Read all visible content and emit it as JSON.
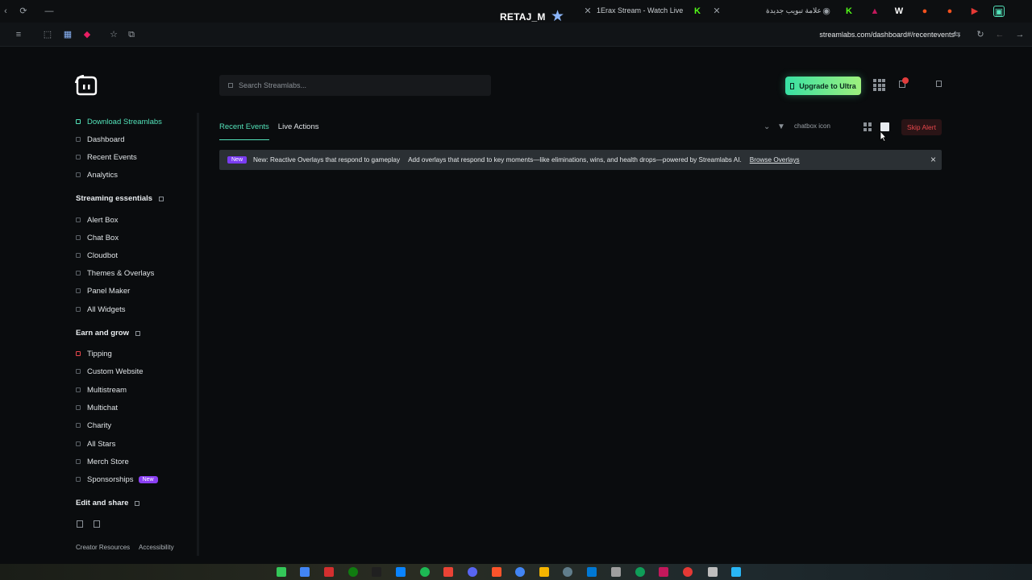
{
  "browser": {
    "tabs": [
      {
        "label": "RETAJ_M"
      },
      {
        "label": "1Erax Stream - Watch Live on K"
      },
      {
        "label": "علامة تبويب جديدة"
      }
    ],
    "url": "streamlabs.com/dashboard#/recentevents"
  },
  "header": {
    "search_placeholder": "Search Streamlabs...",
    "upgrade_label": "Upgrade to Ultra"
  },
  "sidebar": {
    "top_items": [
      {
        "label": "Download Streamlabs"
      },
      {
        "label": "Dashboard"
      },
      {
        "label": "Recent Events"
      },
      {
        "label": "Analytics"
      }
    ],
    "sections": [
      {
        "title": "Streaming essentials",
        "items": [
          "Alert Box",
          "Chat Box",
          "Cloudbot",
          "Themes & Overlays",
          "Panel Maker",
          "All Widgets"
        ]
      },
      {
        "title": "Earn and grow",
        "items": [
          "Tipping",
          "Custom Website",
          "Multistream",
          "Multichat",
          "Charity",
          "All Stars",
          "Merch Store",
          "Sponsorships"
        ]
      },
      {
        "title": "Edit and share",
        "items": []
      }
    ],
    "new_badge": "New",
    "footer": {
      "resources": "Creator Resources",
      "accessibility": "Accessibility"
    }
  },
  "main": {
    "tabs": [
      {
        "label": "Recent Events"
      },
      {
        "label": "Live Actions"
      }
    ],
    "toolbar_text": "chatbox icon",
    "skip_label": "Skip Alert",
    "banner": {
      "badge": "New",
      "lead": "New: Reactive Overlays that respond to gameplay",
      "body": "Add overlays that respond to key moments—like eliminations, wins, and health drops—powered by Streamlabs AI.",
      "link": "Browse Overlays",
      "close": "×"
    }
  },
  "colors": {
    "accent": "#53e2b9",
    "danger": "#e8474c",
    "purple": "#8a3ff2"
  }
}
